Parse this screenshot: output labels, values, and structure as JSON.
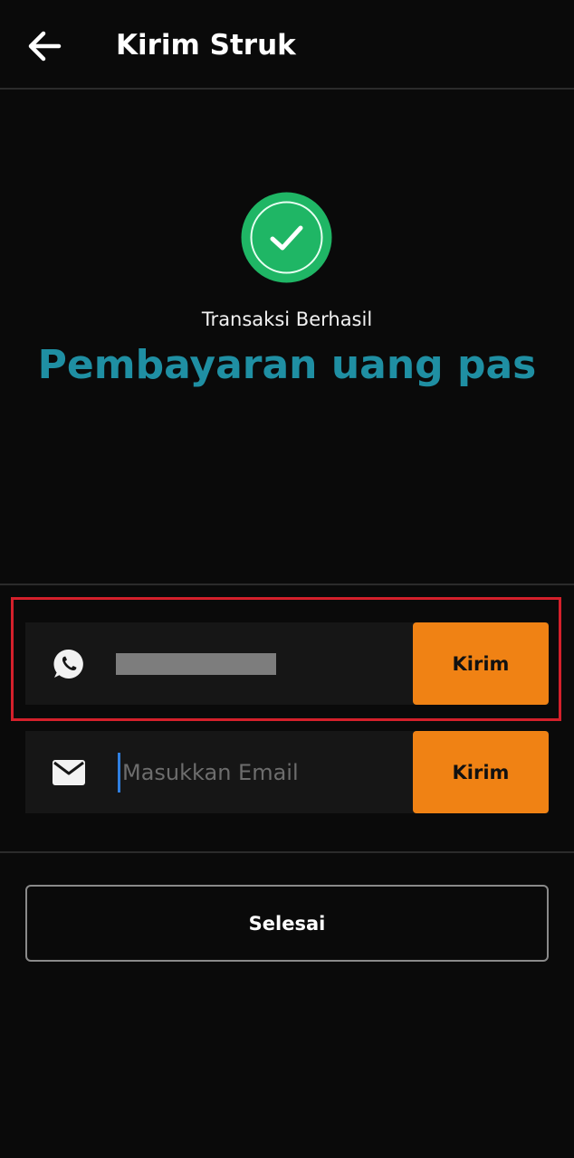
{
  "header": {
    "title": "Kirim Struk",
    "back_icon": "arrow-left-icon"
  },
  "status": {
    "icon": "check-circle-icon",
    "icon_color": "#1fb665",
    "subtitle": "Transaksi Berhasil",
    "headline": "Pembayaran uang pas",
    "headline_color": "#1f8fa3"
  },
  "whatsapp": {
    "icon": "whatsapp-icon",
    "send_label": "Kirim"
  },
  "email": {
    "icon": "mail-icon",
    "placeholder": "Masukkan Email",
    "send_label": "Kirim"
  },
  "footer": {
    "done_label": "Selesai"
  },
  "colors": {
    "accent": "#f08214",
    "highlight": "#d4202b",
    "background": "#0a0a0a"
  }
}
